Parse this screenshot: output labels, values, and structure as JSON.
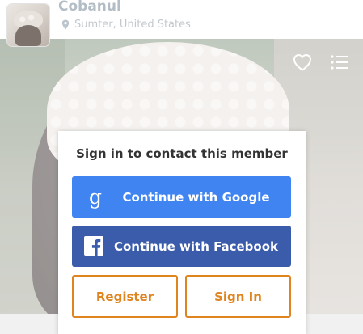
{
  "header": {
    "member_name": "Cobanul",
    "location": "Sumter, United States"
  },
  "icons": {
    "location": "map-pin-icon",
    "favorite": "heart-outline-icon",
    "menu": "list-icon",
    "google": "google-g-icon",
    "facebook": "facebook-f-icon"
  },
  "dialog": {
    "title": "Sign in to contact this member",
    "google_label": "Continue with Google",
    "facebook_label": "Continue with Facebook",
    "register_label": "Register",
    "signin_label": "Sign In"
  },
  "colors": {
    "google_blue": "#3f84f0",
    "facebook_blue": "#3b5bab",
    "accent_orange": "#e0841f",
    "title_text": "#333333"
  }
}
